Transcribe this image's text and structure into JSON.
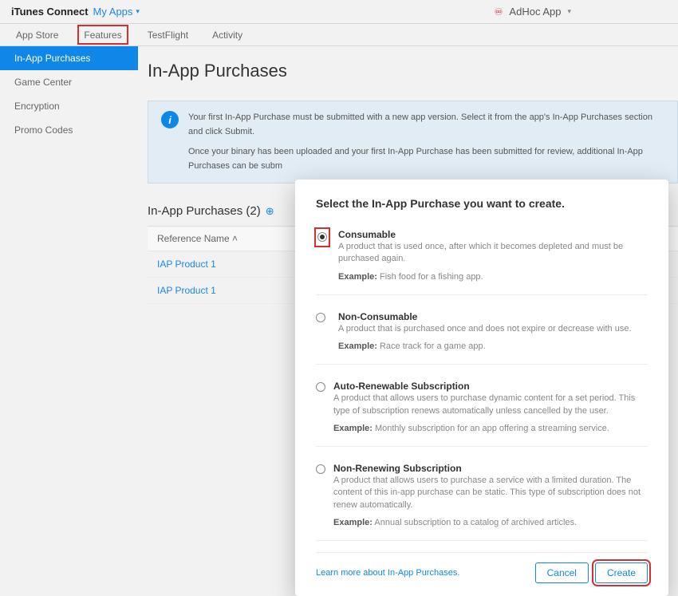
{
  "topbar": {
    "title": "iTunes Connect",
    "myapps": "My Apps",
    "adhoc": "AdHoc App"
  },
  "tabs": {
    "appstore": "App Store",
    "features": "Features",
    "testflight": "TestFlight",
    "activity": "Activity"
  },
  "sidebar": {
    "iap": "In-App Purchases",
    "gamecenter": "Game Center",
    "encryption": "Encryption",
    "promo": "Promo Codes"
  },
  "page": {
    "title": "In-App Purchases",
    "info1": "Your first In-App Purchase must be submitted with a new app version. Select it from the app's In-App Purchases section and click Submit.",
    "info2": "Once your binary has been uploaded and your first In-App Purchase has been submitted for review, additional In-App Purchases can be subm",
    "subheading": "In-App Purchases (2)",
    "col_refname": "Reference Name ˄",
    "rows": [
      "IAP Product 1",
      "IAP Product 1"
    ]
  },
  "modal": {
    "title": "Select the In-App Purchase you want to create.",
    "options": [
      {
        "name": "Consumable",
        "desc": "A product that is used once, after which it becomes depleted and must be purchased again.",
        "example_label": "Example:",
        "example_text": " Fish food for a fishing app."
      },
      {
        "name": "Non-Consumable",
        "desc": "A product that is purchased once and does not expire or decrease with use.",
        "example_label": "Example:",
        "example_text": " Race track for a game app."
      },
      {
        "name": "Auto-Renewable Subscription",
        "desc": "A product that allows users to purchase dynamic content for a set period. This type of subscription renews automatically unless cancelled by the user.",
        "example_label": "Example:",
        "example_text": " Monthly subscription for an app offering a streaming service."
      },
      {
        "name": "Non-Renewing Subscription",
        "desc": "A product that allows users to purchase a service with a limited duration. The content of this in-app purchase can be static. This type of subscription does not renew automatically.",
        "example_label": "Example:",
        "example_text": " Annual subscription to a catalog of archived articles."
      }
    ],
    "learn": "Learn more about In-App Purchases.",
    "cancel": "Cancel",
    "create": "Create"
  }
}
